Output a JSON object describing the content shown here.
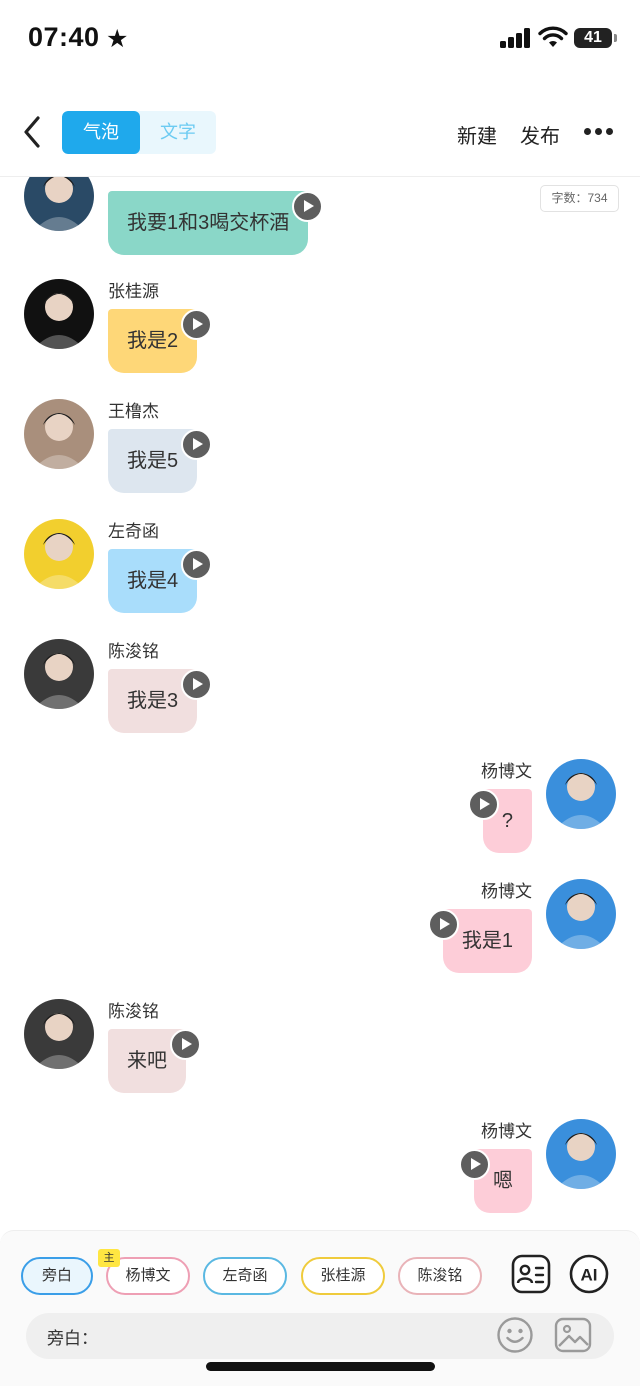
{
  "status_bar": {
    "time": "07:40",
    "battery": "41"
  },
  "nav": {
    "tab_bubble": "气泡",
    "tab_text": "文字",
    "new": "新建",
    "publish": "发布"
  },
  "word_count": "字数：734",
  "messages": [
    {
      "side": "left",
      "name": "",
      "text": "我要1和3喝交杯酒",
      "color": "#8ad7c8",
      "avatar": "#2a4a66"
    },
    {
      "side": "left",
      "name": "张桂源",
      "text": "我是2",
      "color": "#fed778",
      "avatar": "#111111"
    },
    {
      "side": "left",
      "name": "王橹杰",
      "text": "我是5",
      "color": "#dde6ef",
      "avatar": "#a98f7c"
    },
    {
      "side": "left",
      "name": "左奇函",
      "text": "我是4",
      "color": "#a9ddfb",
      "avatar": "#f2cf2e"
    },
    {
      "side": "left",
      "name": "陈浚铭",
      "text": "我是3",
      "color": "#f1dfdf",
      "avatar": "#3a3a3a"
    },
    {
      "side": "right",
      "name": "杨博文",
      "text": "?",
      "color": "#fdcdd8",
      "avatar": "#3a8fdc"
    },
    {
      "side": "right",
      "name": "杨博文",
      "text": "我是1",
      "color": "#fdcdd8",
      "avatar": "#3a8fdc"
    },
    {
      "side": "left",
      "name": "陈浚铭",
      "text": "来吧",
      "color": "#f1dfdf",
      "avatar": "#3a3a3a"
    },
    {
      "side": "right",
      "name": "杨博文",
      "text": "嗯",
      "color": "#fdcdd8",
      "avatar": "#3a8fdc"
    }
  ],
  "roles": [
    {
      "label": "旁白",
      "border": "#3a9ee8",
      "selected": true
    },
    {
      "label": "杨博文",
      "border": "#ee9fb4",
      "tag": "主"
    },
    {
      "label": "左奇函",
      "border": "#5ab8e2"
    },
    {
      "label": "张桂源",
      "border": "#efcb3c"
    },
    {
      "label": "陈浚铭",
      "border": "#e9b3b8"
    }
  ],
  "input": {
    "label": "旁白：",
    "value": ""
  },
  "ai_label": "AI"
}
